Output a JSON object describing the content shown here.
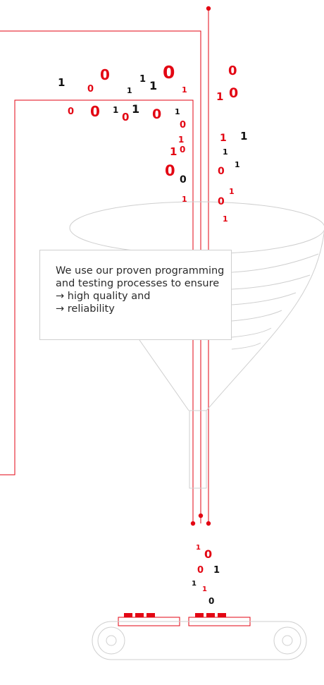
{
  "callout": {
    "intro_line1": "We use our proven programming",
    "intro_line2": "and testing processes to ensure",
    "bullet_1": "→ high quality and",
    "bullet_2": "→ reliability"
  },
  "colors": {
    "accent": "#e30613",
    "ink": "#111111",
    "outline": "#c8c8c8"
  },
  "binary_digits": [
    {
      "t": "1",
      "c": "ink"
    },
    {
      "t": "0",
      "c": "accent"
    },
    {
      "t": "0",
      "c": "accent"
    },
    {
      "t": "1",
      "c": "ink"
    },
    {
      "t": "1",
      "c": "ink"
    },
    {
      "t": "1",
      "c": "ink"
    },
    {
      "t": "0",
      "c": "accent"
    },
    {
      "t": "1",
      "c": "accent"
    },
    {
      "t": "0",
      "c": "accent"
    },
    {
      "t": "1",
      "c": "accent"
    },
    {
      "t": "0",
      "c": "accent"
    },
    {
      "t": "0",
      "c": "accent"
    },
    {
      "t": "0",
      "c": "accent"
    },
    {
      "t": "1",
      "c": "ink"
    },
    {
      "t": "0",
      "c": "accent"
    },
    {
      "t": "1",
      "c": "ink"
    },
    {
      "t": "0",
      "c": "accent"
    },
    {
      "t": "1",
      "c": "ink"
    },
    {
      "t": "0",
      "c": "accent"
    },
    {
      "t": "1",
      "c": "accent"
    },
    {
      "t": "1",
      "c": "accent"
    },
    {
      "t": "1",
      "c": "ink"
    },
    {
      "t": "1",
      "c": "accent"
    },
    {
      "t": "0",
      "c": "accent"
    },
    {
      "t": "1",
      "c": "ink"
    },
    {
      "t": "0",
      "c": "accent"
    },
    {
      "t": "1",
      "c": "ink"
    },
    {
      "t": "0",
      "c": "accent"
    },
    {
      "t": "0",
      "c": "ink"
    },
    {
      "t": "1",
      "c": "accent"
    },
    {
      "t": "0",
      "c": "accent"
    },
    {
      "t": "1",
      "c": "accent"
    },
    {
      "t": "1",
      "c": "accent"
    },
    {
      "t": "1",
      "c": "accent"
    },
    {
      "t": "0",
      "c": "accent"
    },
    {
      "t": "0",
      "c": "accent"
    },
    {
      "t": "1",
      "c": "ink"
    },
    {
      "t": "1",
      "c": "ink"
    },
    {
      "t": "1",
      "c": "accent"
    },
    {
      "t": "0",
      "c": "ink"
    }
  ]
}
